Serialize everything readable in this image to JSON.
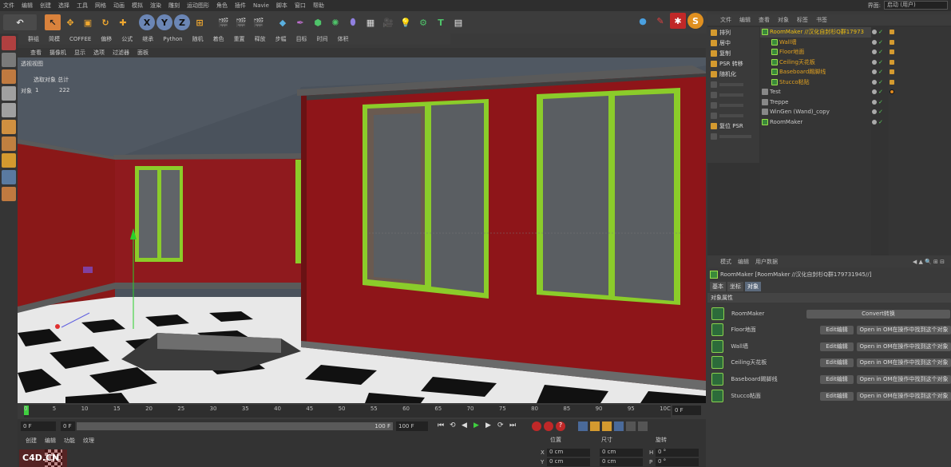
{
  "menubar": {
    "items": [
      "文件",
      "编辑",
      "创建",
      "选择",
      "工具",
      "网格",
      "动画",
      "模拟",
      "渲染",
      "雕刻",
      "运动图形",
      "角色",
      "插件",
      "Navie",
      "脚本",
      "窗口",
      "帮助"
    ],
    "layout_label": "界面:",
    "layout_value": "启动 (用户)"
  },
  "vp_menu": {
    "items": [
      "查看",
      "摄像机",
      "显示",
      "选项",
      "过滤器",
      "面板"
    ]
  },
  "toolbar2": {
    "items": [
      "群组",
      "简模",
      "COFFEE",
      "偏移",
      "公式",
      "继承",
      "Python",
      "随机",
      "着色",
      "重置",
      "释放",
      "步幅",
      "目标",
      "时间",
      "体积"
    ]
  },
  "viewport": {
    "label": "透视视图",
    "info_header": "选取对象 总计",
    "info_label": "对象",
    "info_selected": "1",
    "info_total": "222"
  },
  "om": {
    "menu": [
      "文件",
      "编辑",
      "查看",
      "对象",
      "标签",
      "书签"
    ],
    "tags": [
      {
        "label": "排列",
        "dim": false
      },
      {
        "label": "居中",
        "dim": false
      },
      {
        "label": "复制",
        "dim": false
      },
      {
        "label": "PSR 转移",
        "dim": false
      },
      {
        "label": "随机化",
        "dim": false
      },
      {
        "label": "",
        "dim": true
      },
      {
        "label": "",
        "dim": true
      },
      {
        "label": "",
        "dim": true
      },
      {
        "label": "",
        "dim": true
      },
      {
        "label": "复位 PSR",
        "dim": false
      },
      {
        "label": "",
        "dim": true
      }
    ],
    "objects": [
      {
        "name": "RoomMaker //汉化自封杉Q群17973",
        "color": "#f0c010",
        "indent": 0
      },
      {
        "name": "Wall墙",
        "color": "#e0a020",
        "indent": 12
      },
      {
        "name": "Floor地面",
        "color": "#e0a020",
        "indent": 12
      },
      {
        "name": "Ceiling天花板",
        "color": "#e0a020",
        "indent": 12
      },
      {
        "name": "Baseboard踢脚线",
        "color": "#e0a020",
        "indent": 12
      },
      {
        "name": "Stucco粘贴",
        "color": "#e0a020",
        "indent": 12
      },
      {
        "name": "Test",
        "color": "#c8c8c8",
        "indent": 0
      },
      {
        "name": "Treppe",
        "color": "#c8c8c8",
        "indent": 0
      },
      {
        "name": "WinGen (Wand)_copy",
        "color": "#c8c8c8",
        "indent": 0
      },
      {
        "name": "RoomMaker",
        "color": "#c8c8c8",
        "indent": 0
      }
    ]
  },
  "attr": {
    "menu": [
      "模式",
      "编辑",
      "用户数据"
    ],
    "title": "RoomMaker [RoomMaker //汉化自封杉Q群179731945//]",
    "tabs": [
      "基本",
      "坐标",
      "对象"
    ],
    "section": "对象属性",
    "roommaker_label": "RoomMaker",
    "convert_btn": "Convert转换",
    "rows": [
      {
        "label": "Floor地面",
        "edit": "Edit编辑",
        "open": "Open in OM在操作中找到这个对象"
      },
      {
        "label": "Wall墙",
        "edit": "Edit编辑",
        "open": "Open in OM在操作中找到这个对象"
      },
      {
        "label": "Ceiling天花板",
        "edit": "Edit编辑",
        "open": "Open in OM在操作中找到这个对象"
      },
      {
        "label": "Baseboard踢脚线",
        "edit": "Edit编辑",
        "open": "Open in OM在操作中找到这个对象"
      },
      {
        "label": "Stucco粘面",
        "edit": "Edit编辑",
        "open": "Open in OM在操作中找到这个对象"
      }
    ]
  },
  "timeline": {
    "ticks": [
      "0",
      "5",
      "10",
      "15",
      "20",
      "25",
      "30",
      "35",
      "40",
      "45",
      "50",
      "55",
      "60",
      "65",
      "70",
      "75",
      "80",
      "85",
      "90",
      "95",
      "10C"
    ],
    "frame_end": "0 F"
  },
  "transport": {
    "start": "0 F",
    "cur": "0 F",
    "end": "100 F",
    "end2": "100 F"
  },
  "bottom": {
    "menu": [
      "创建",
      "编辑",
      "功能",
      "纹理"
    ]
  },
  "coords": {
    "h1": "位置",
    "h2": "尺寸",
    "h3": "旋转",
    "x": "0 cm",
    "y": "0 cm",
    "sx": "0 cm",
    "sy": "0 cm",
    "h": "0 °",
    "p": "0 °"
  },
  "logo": "C4D.CN"
}
